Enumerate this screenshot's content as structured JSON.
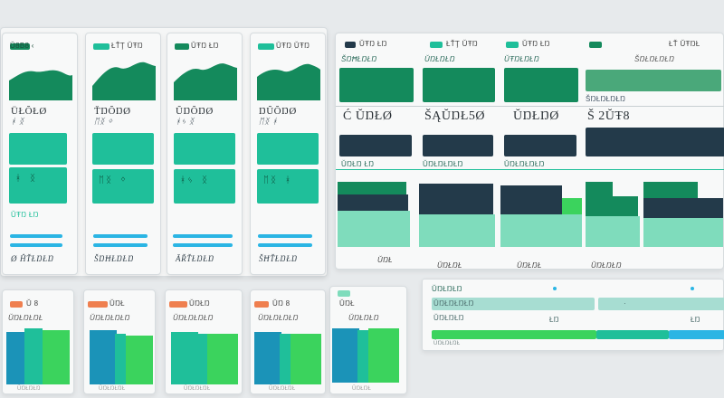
{
  "colors": {
    "green_dark": "#148a5c",
    "teal": "#1fbf9a",
    "mint": "#7fdcbc",
    "navy": "#233a4a",
    "cyan": "#2bb5e4",
    "orange": "#ef7f4f",
    "bright_green": "#3bd35d",
    "blue_teal": "#1b93b8"
  },
  "top_cards": [
    {
      "header": "Ŭ8B8 ‹",
      "value": "ÜŁŎŁØ",
      "digits": "ᚼ  ᛝ",
      "footer_tag": "ŬŦŊ ŁŊ",
      "footer": "Ø ĤŤŁŊŁŊ"
    },
    {
      "header": "ŁŤŢ ŬŦŊ",
      "value": "ŤŊŎŊØ",
      "digits": "ᛖᛝ ᛜ",
      "footer_tag": "ŬŦŊ ŁŊ",
      "footer": "ŠŊĦŁŊŁŊ"
    },
    {
      "header": "ŬŦŊ ŁŊ",
      "value": "ŬŊŎŊØ",
      "digits": "ᚼᛃ ᛝ",
      "footer_tag": "ŬŦŊ ŁŊ",
      "footer": "ĂŘŤŁŊŁŊ"
    },
    {
      "header": "ŬŦŊ ŬŦŊ",
      "value": "ŊŬŎŊØ",
      "digits": "ᛖᛝ ᚼ",
      "footer_tag": "ŬŦŊ ŁŊ",
      "footer": "ŠĦŤŁŊŁŊ"
    }
  ],
  "main_panel": {
    "headers": [
      "ŬŦŊ ŁŊ",
      "ŁŤŢ ŬŦŊ",
      "ŬŦŊ ŁŊ",
      "ŁŤ ŬŦŊŁ"
    ],
    "subheaders": [
      "ŠŊĦŁŊŁŊ",
      "ŬŊŁŊŁŊ",
      "ŬŦŊŁŊŁŊ",
      "ŠŊŁŊŁŊŁŊ"
    ],
    "values": [
      "Ć ŬŊŁØ",
      "ŠĄŬŊŁ5Ø",
      "ŬŊŁŊØ",
      "Š 2ŬŦ8"
    ],
    "section_labels": [
      "ŬŊŁŊ ŁŊ",
      "ŬŊŁŊŁŊŁŊ",
      "ŬŊŁŊŁŊŁŊ",
      "ŠŊŁŊŁŊŁŊ"
    ],
    "footer": [
      "ŬŊŁ",
      "ŬŊŁŊŁ",
      "ŬŊŁŊŁ",
      "ŬŊŁŊŁŊ"
    ]
  },
  "bottom_cards": [
    {
      "header": "Ŭ 8",
      "subtitle": "ŬŊŁŊŁŊŁ",
      "caption": "ŬŊŁŊŁŊ"
    },
    {
      "header": "ŬŊŁ",
      "subtitle": "ŬŊŁŊŁŊŁŊ",
      "caption": "ŬŊŁŊŁŊŁ"
    },
    {
      "header": "ŬŊŁŊ",
      "subtitle": "ŬŊŁŊŁŊŁŊ",
      "caption": "ŬŊŁŊŁŊŁ"
    },
    {
      "header": "ŬŊ 8",
      "subtitle": "ŬŊŁŊŁŊŁŊ",
      "caption": "ŬŊŁŊŁŊŁ"
    },
    {
      "header": "ŬŊŁ",
      "subtitle": "ŬŊŁŊŁŊ",
      "caption": "ŬŊŁŊŁ"
    }
  ],
  "table_panel": {
    "title": "ŬŊŁŊŁŊ",
    "rows": [
      {
        "label": "ŬŊŁŊŁŊŁŊ",
        "marker": "·"
      },
      {
        "label": "ŬŊŁŊŁŊ",
        "marker": "ŁŊ"
      },
      {
        "label": "ŬŊŁŊŁŊŁ",
        "marker": "ŁŊ"
      }
    ]
  }
}
